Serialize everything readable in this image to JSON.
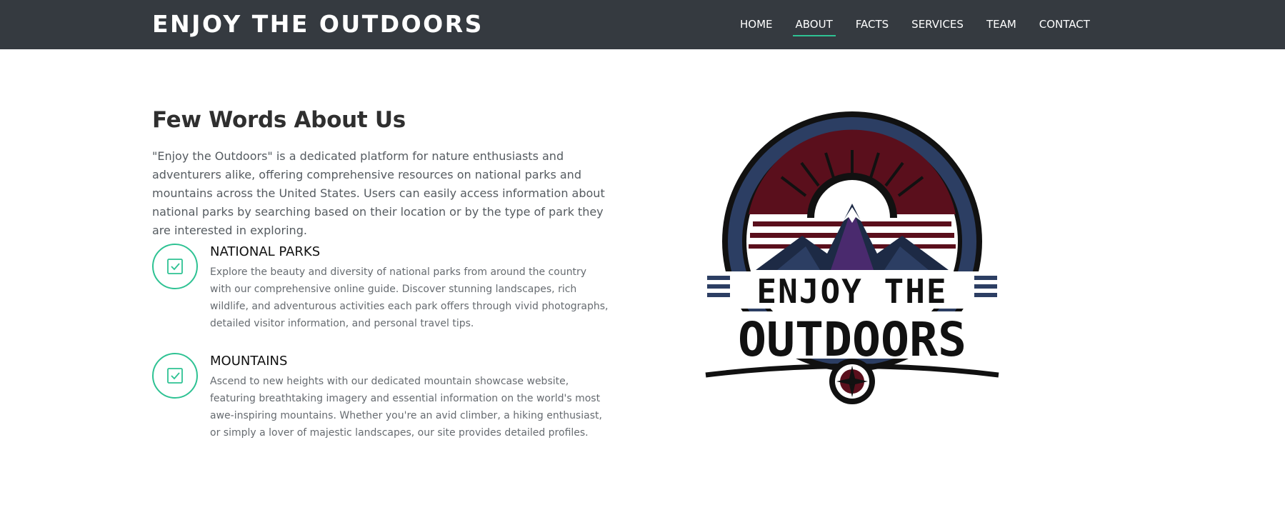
{
  "header": {
    "brand": "ENJOY THE OUTDOORS",
    "nav": [
      {
        "label": "HOME",
        "active": false
      },
      {
        "label": "ABOUT",
        "active": true
      },
      {
        "label": "FACTS",
        "active": false
      },
      {
        "label": "SERVICES",
        "active": false
      },
      {
        "label": "TEAM",
        "active": false
      },
      {
        "label": "CONTACT",
        "active": false
      }
    ]
  },
  "about": {
    "title": "Few Words About Us",
    "intro": "\"Enjoy the Outdoors\" is a dedicated platform for nature enthusiasts and adventurers alike, offering comprehensive resources on national parks and mountains across the United States. Users can easily access information about national parks by searching based on their location or by the type of park they are interested in exploring.",
    "features": [
      {
        "icon": "checkbox-icon",
        "title": "NATIONAL PARKS",
        "description": "Explore the beauty and diversity of national parks from around the country with our comprehensive online guide. Discover stunning landscapes, rich wildlife, and adventurous activities each park offers through vivid photographs, detailed visitor information, and personal travel tips."
      },
      {
        "icon": "checkbox-icon",
        "title": "MOUNTAINS",
        "description": "Ascend to new heights with our dedicated mountain showcase website, featuring breathtaking imagery and essential information on the world's most awe-inspiring mountains. Whether you're an avid climber, a hiking enthusiast, or simply a lover of majestic landscapes, our site provides detailed profiles."
      }
    ],
    "logo": {
      "line1": "ENJOY THE",
      "line2": "OUTDOORS"
    }
  },
  "colors": {
    "header_bg": "#353a40",
    "accent": "#2ec293",
    "logo_navy": "#2c3e63",
    "logo_maroon": "#5a0f1c"
  }
}
